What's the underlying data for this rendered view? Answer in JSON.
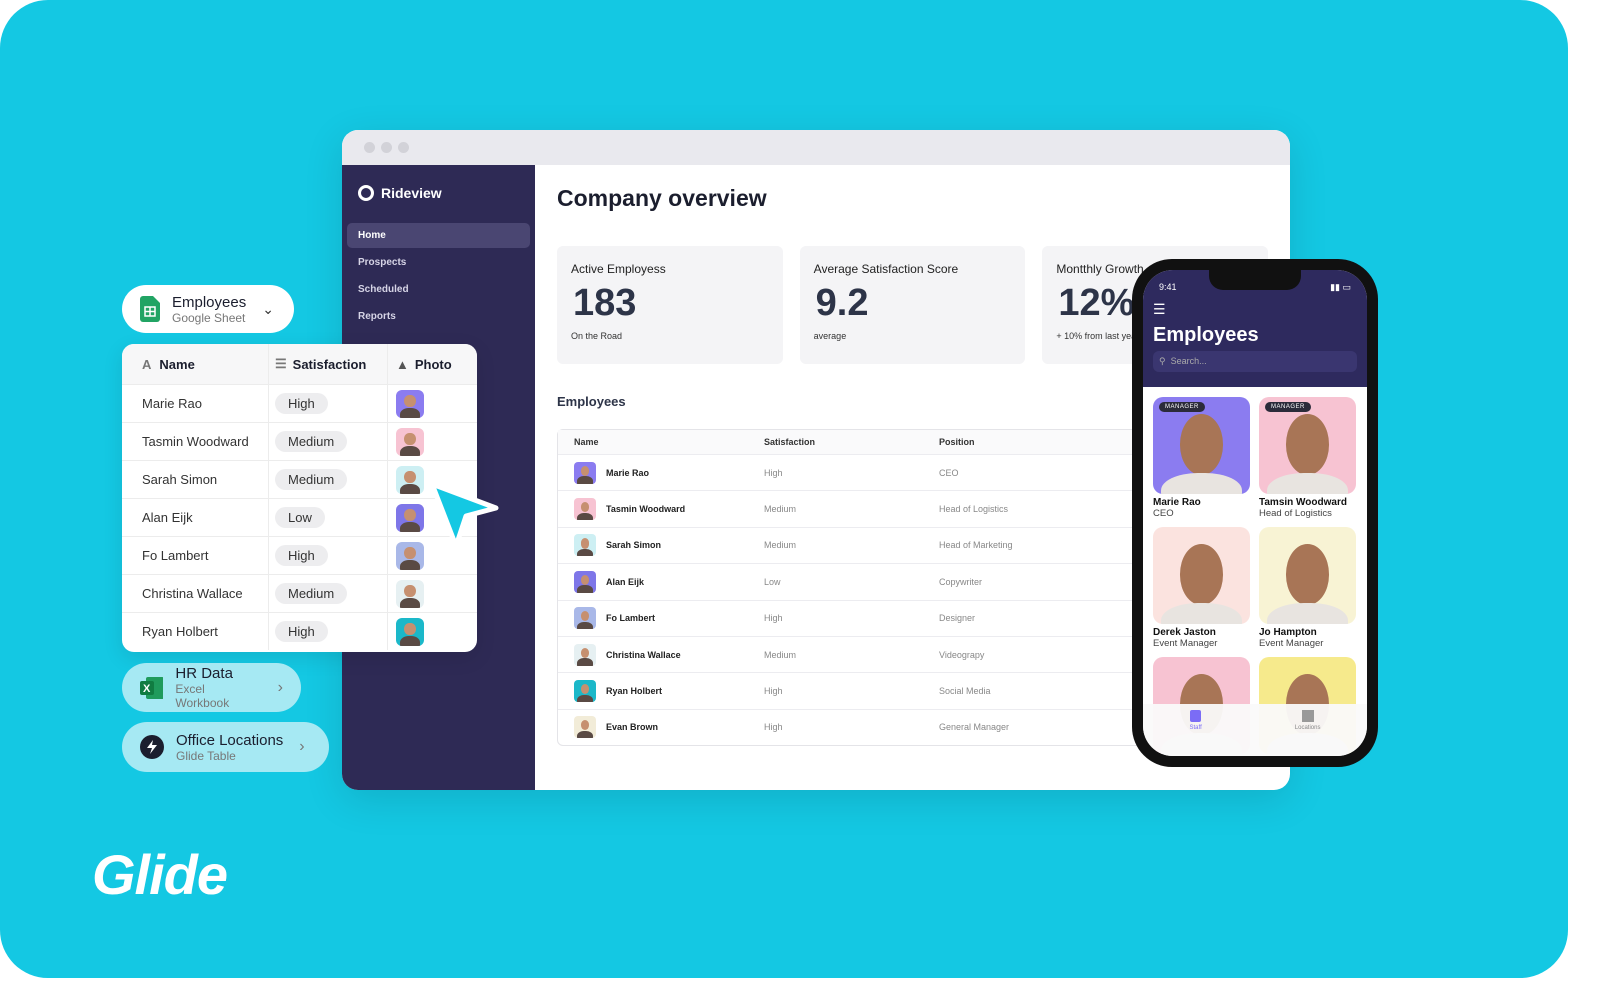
{
  "colors": {
    "background": "#14c8e3",
    "sidebar": "#2e2a55",
    "accent": "#7b6cf6"
  },
  "logo": "Glide",
  "window": {
    "brand": "Rideview",
    "nav": [
      {
        "label": "Home",
        "active": true
      },
      {
        "label": "Prospects"
      },
      {
        "label": "Scheduled"
      },
      {
        "label": "Reports"
      }
    ],
    "title": "Company overview",
    "cards": [
      {
        "title": "Active Employess",
        "value": "183",
        "sub": "On the Road"
      },
      {
        "title": "Average Satisfaction Score",
        "value": "9.2",
        "sub": "average"
      },
      {
        "title": "Montthly Growth",
        "value": "12%",
        "sub": "+ 10% from last year"
      }
    ],
    "section": "Employees",
    "columns": [
      "Name",
      "Satisfaction",
      "Position"
    ],
    "rows": [
      {
        "name": "Marie Rao",
        "sat": "High",
        "pos": "CEO",
        "color": "#8b7cf0"
      },
      {
        "name": "Tasmin Woodward",
        "sat": "Medium",
        "pos": "Head of Logistics",
        "color": "#f7c3d2"
      },
      {
        "name": "Sarah Simon",
        "sat": "Medium",
        "pos": "Head of Marketing",
        "color": "#cdeff3"
      },
      {
        "name": "Alan Eijk",
        "sat": "Low",
        "pos": "Copywriter",
        "color": "#7e76e8"
      },
      {
        "name": "Fo Lambert",
        "sat": "High",
        "pos": "Designer",
        "color": "#a9b8e8"
      },
      {
        "name": "Christina Wallace",
        "sat": "Medium",
        "pos": "Videograpy",
        "color": "#e6f0f2"
      },
      {
        "name": "Ryan Holbert",
        "sat": "High",
        "pos": "Social Media",
        "color": "#1bb8c9"
      },
      {
        "name": "Evan Brown",
        "sat": "High",
        "pos": "General Manager",
        "color": "#f2ecd8"
      }
    ]
  },
  "sources": {
    "employees": {
      "name": "Employees",
      "sub": "Google Sheet"
    },
    "hr": {
      "name": "HR Data",
      "sub": "Excel Workbook"
    },
    "office": {
      "name": "Office Locations",
      "sub": "Glide Table"
    }
  },
  "sheet": {
    "columns": [
      "Name",
      "Satisfaction",
      "Photo"
    ],
    "rows": [
      {
        "name": "Marie Rao",
        "sat": "High",
        "color": "#8b7cf0"
      },
      {
        "name": "Tasmin Woodward",
        "sat": "Medium",
        "color": "#f7c3d2"
      },
      {
        "name": "Sarah Simon",
        "sat": "Medium",
        "color": "#cdeff3"
      },
      {
        "name": "Alan Eijk",
        "sat": "Low",
        "color": "#7e76e8"
      },
      {
        "name": "Fo Lambert",
        "sat": "High",
        "color": "#a9b8e8"
      },
      {
        "name": "Christina Wallace",
        "sat": "Medium",
        "color": "#e6f0f2"
      },
      {
        "name": "Ryan Holbert",
        "sat": "High",
        "color": "#1bb8c9"
      }
    ]
  },
  "phone": {
    "time": "9:41",
    "title": "Employees",
    "search_placeholder": "Search...",
    "people": [
      {
        "name": "Marie Rao",
        "role": "CEO",
        "badge": "MANAGER",
        "color": "#8b7cf0"
      },
      {
        "name": "Tamsin Woodward",
        "role": "Head of Logistics",
        "badge": "MANAGER",
        "color": "#f7c3d2"
      },
      {
        "name": "Derek Jaston",
        "role": "Event Manager",
        "color": "#fbe3df"
      },
      {
        "name": "Jo Hampton",
        "role": "Event Manager",
        "color": "#f8f3d4"
      },
      {
        "name": "",
        "role": "",
        "color": "#f7c3d2"
      },
      {
        "name": "",
        "role": "",
        "color": "#f6ea8c"
      }
    ],
    "tabs": [
      {
        "label": "Staff",
        "active": true
      },
      {
        "label": "Locations"
      }
    ]
  }
}
